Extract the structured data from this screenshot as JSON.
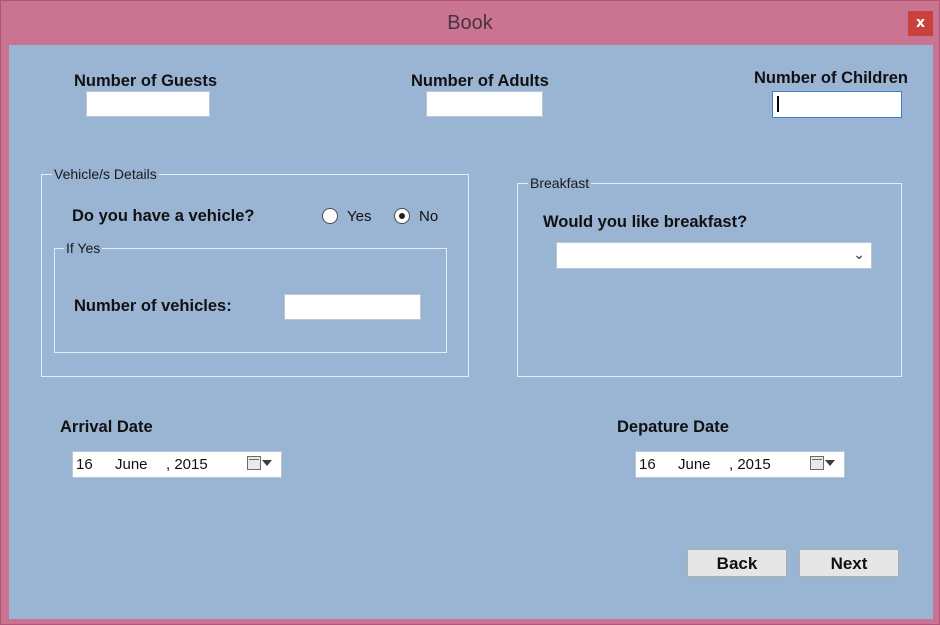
{
  "window": {
    "title": "Book",
    "close_glyph": "x"
  },
  "guests": {
    "label": "Number of Guests",
    "value": ""
  },
  "adults": {
    "label": "Number of Adults",
    "value": ""
  },
  "children": {
    "label": "Number of Children",
    "value": ""
  },
  "vehicle": {
    "group_title": "Vehicle/s Details",
    "question": "Do you have a vehicle?",
    "yes_label": "Yes",
    "no_label": "No",
    "selected": "No",
    "ifyes_title": "If Yes",
    "count_label": "Number of vehicles:",
    "count_value": ""
  },
  "breakfast": {
    "group_title": "Breakfast",
    "question": "Would you like breakfast?",
    "selected": ""
  },
  "arrival": {
    "label": "Arrival Date",
    "day": "16",
    "month": "June",
    "year": ", 2015"
  },
  "departure": {
    "label": "Depature Date",
    "day": "16",
    "month": "June",
    "year": ", 2015"
  },
  "buttons": {
    "back": "Back",
    "next": "Next"
  },
  "icons": {
    "close": "close-icon",
    "dropdown": "chevron-down-icon",
    "calendar": "calendar-icon"
  }
}
